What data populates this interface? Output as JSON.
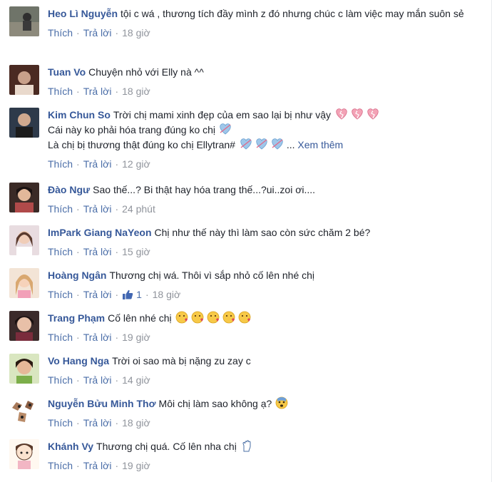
{
  "labels": {
    "like": "Thích",
    "reply": "Trả lời",
    "see_more": "Xem thêm",
    "sep": "·"
  },
  "comments": [
    {
      "author": "Heo Lì Nguyễn",
      "text": "tội c wá , thương tích đầy mình z đó nhưng chúc c làm việc may mắn suôn sẻ",
      "time": "18 giờ",
      "avatar_icon": "avatar-photo"
    },
    {
      "author": "Tuan Vo",
      "text": "Chuyện nhỏ với Elly nà ^^",
      "time": "18 giờ",
      "avatar_icon": "avatar-photo"
    },
    {
      "author": "Kim Chun So",
      "line1": "Trời chị mami xinh đẹp của em sao lại bị như vậy",
      "line2": "Cái này ko phải hóa trang đúng ko chị",
      "line3": "Là chị bị thương thật đúng ko chị Ellytran#",
      "time": "12 giờ",
      "emoji_line1": "broken-heart-icon",
      "emoji_line2": "cupid-heart-icon",
      "avatar_icon": "avatar-photo"
    },
    {
      "author": "Đào Ngư",
      "text": "Sao thế...? Bi thật hay hóa trang thế...?ui..zoi ơi....",
      "time": "24 phút",
      "avatar_icon": "avatar-photo"
    },
    {
      "author": "ImPark Giang NaYeon",
      "text": "Chị như thế này thì làm sao còn sức chăm 2 bé?",
      "time": "15 giờ",
      "avatar_icon": "avatar-photo"
    },
    {
      "author": "Hoàng Ngân",
      "text": "Thương chị wá. Thôi vì sắp nhỏ cố lên nhé chị",
      "time": "18 giờ",
      "likes": "1",
      "avatar_icon": "avatar-photo"
    },
    {
      "author": "Trang Phạm",
      "text": "Cố lên nhé chị",
      "time": "19 giờ",
      "emoji": "kiss-face-icon",
      "avatar_icon": "avatar-photo"
    },
    {
      "author": "Vo Hang Nga",
      "text": "Trời oi sao mà bị nặng zu zay c",
      "time": "14 giờ",
      "avatar_icon": "avatar-photo"
    },
    {
      "author": "Nguyễn Bửu Minh Thơ",
      "text": "Môi chị làm sao không ạ?",
      "time": "18 giờ",
      "emoji": "fearful-face-icon",
      "avatar_icon": "avatar-photo"
    },
    {
      "author": "Khánh Vy",
      "text": "Thương chị quá. Cố lên nha chị",
      "time": "19 giờ",
      "emoji": "raised-fist-icon",
      "avatar_icon": "avatar-cartoon"
    }
  ],
  "colors": {
    "author": "#365899",
    "meta": "#90949c",
    "link": "#4b6ea8",
    "text": "#1d2129"
  }
}
